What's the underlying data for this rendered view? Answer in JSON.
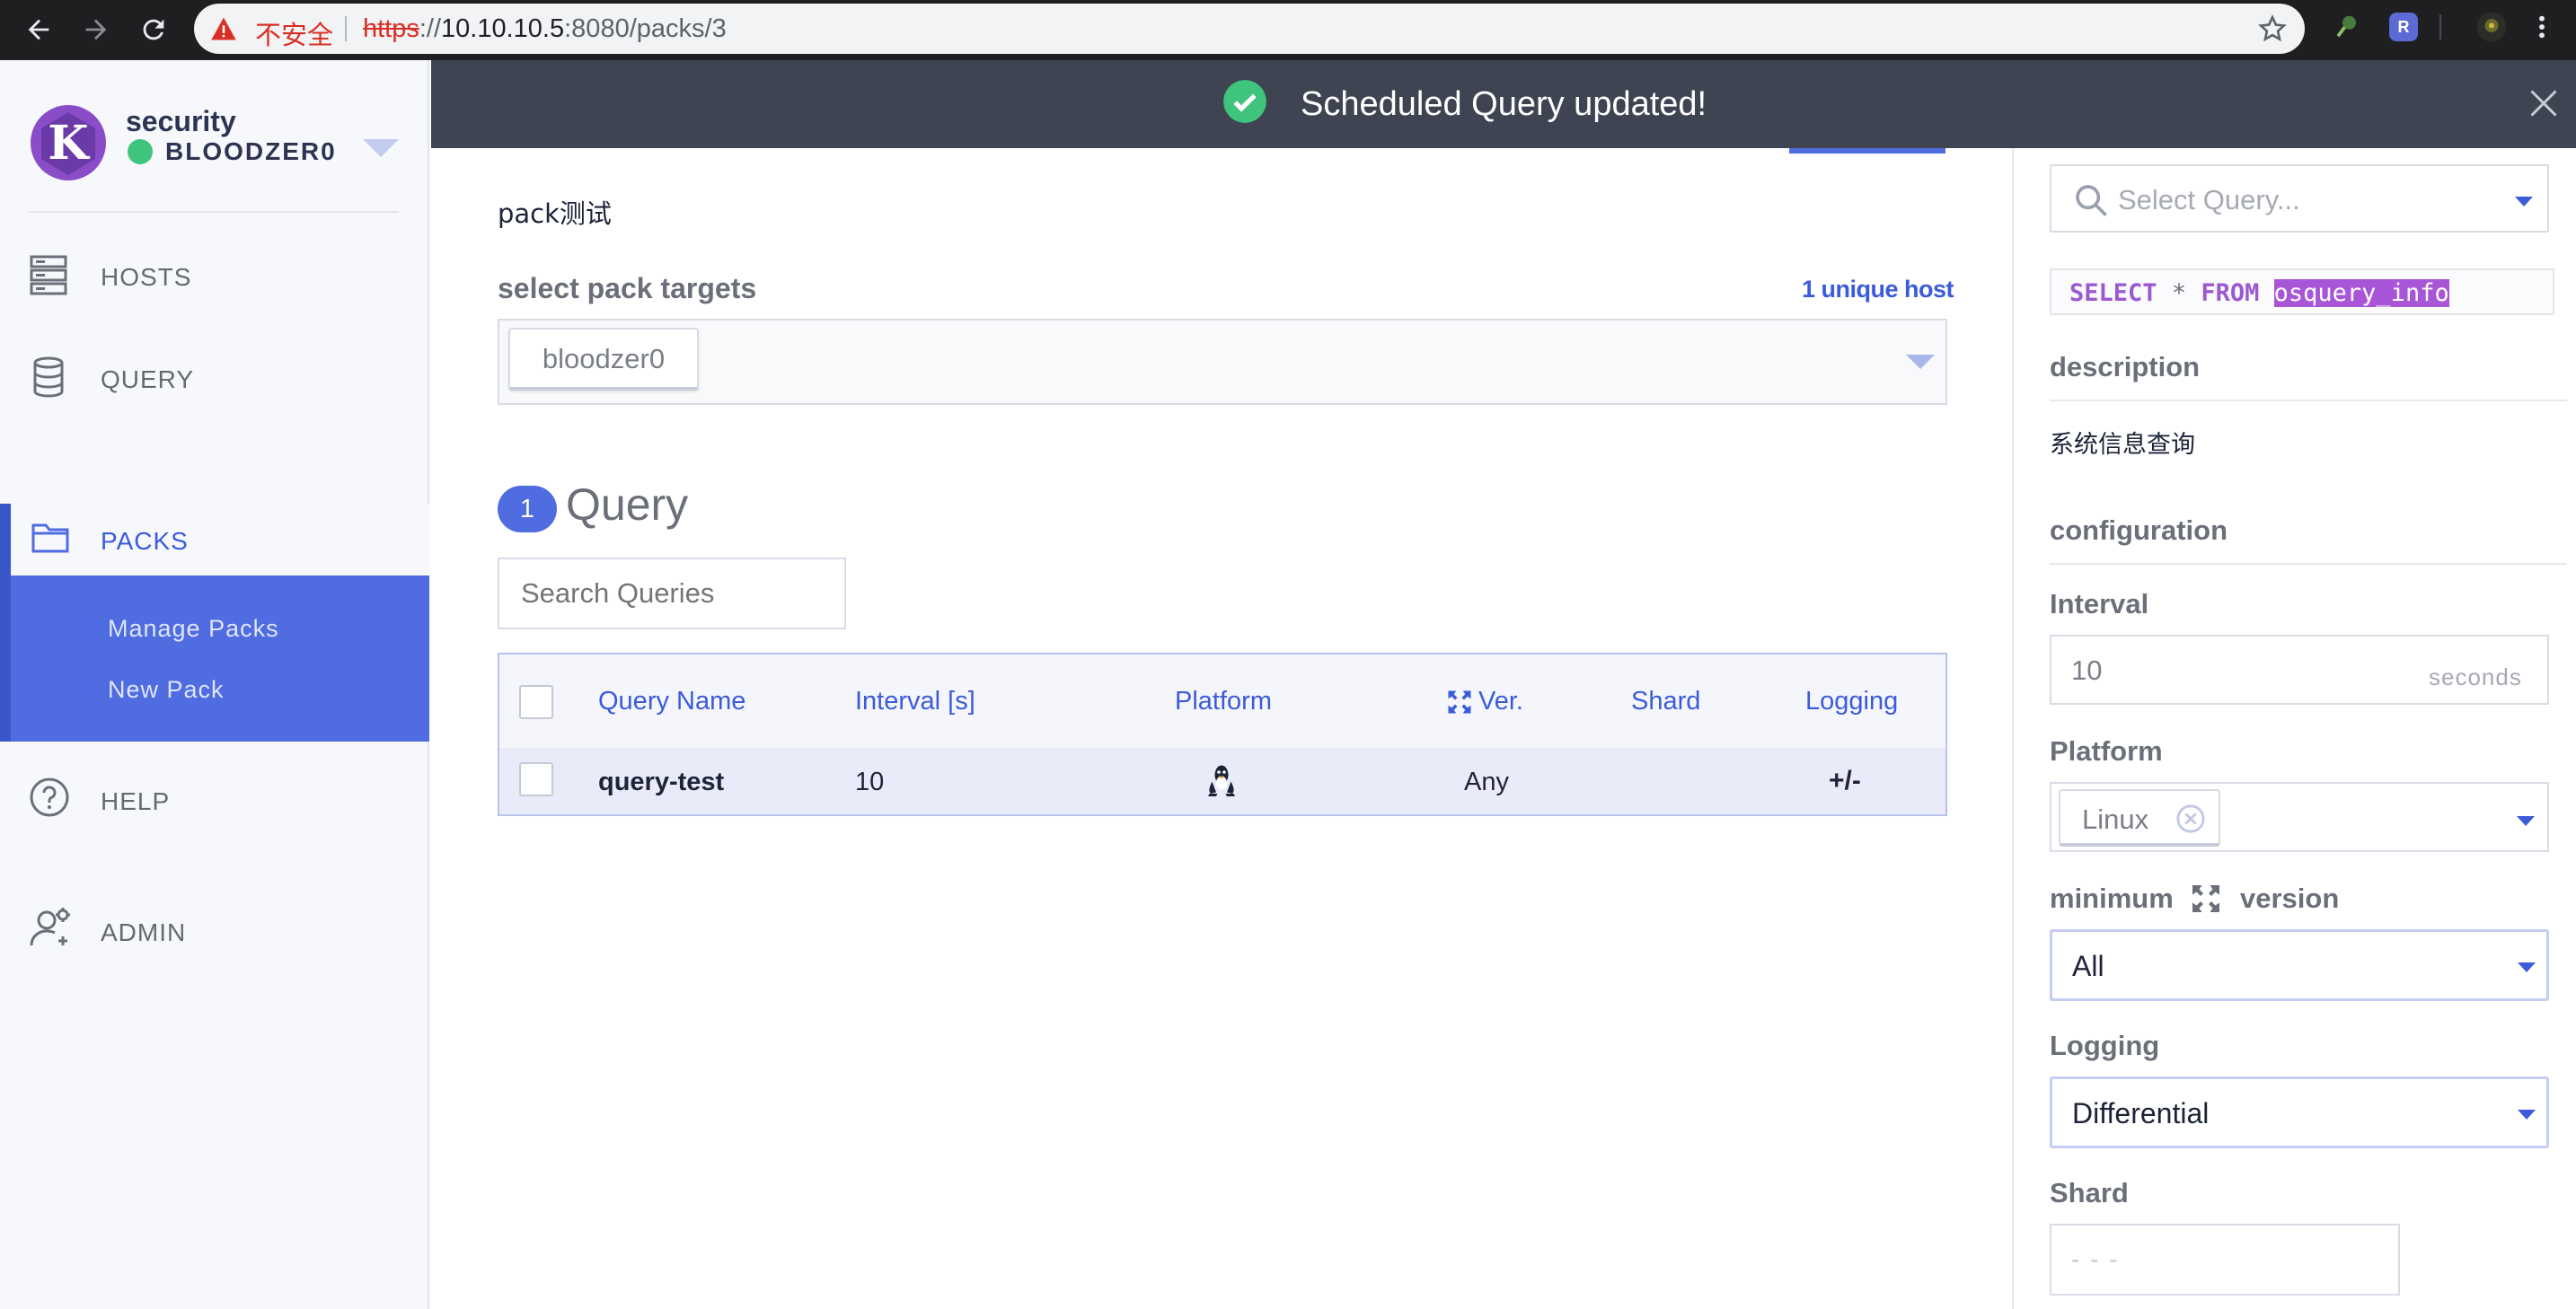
{
  "browser": {
    "insecure_label": "不安全",
    "url_protocol": "https",
    "url_sep": "://",
    "url_host": "10.10.10.5",
    "url_rest": ":8080/packs/3",
    "ext_r_label": "R"
  },
  "sidebar": {
    "org_name": "security",
    "user_name": "BLOODZER0",
    "logo_letter": "K",
    "items": [
      {
        "label": "HOSTS"
      },
      {
        "label": "QUERY"
      },
      {
        "label": "PACKS"
      },
      {
        "label": "HELP"
      },
      {
        "label": "ADMIN"
      }
    ],
    "packs_sub": [
      "Manage Packs",
      "New Pack"
    ]
  },
  "toast": {
    "message": "Scheduled Query updated!"
  },
  "main": {
    "pack_name": "pack测试",
    "targets_label": "select pack targets",
    "unique_hosts": "1 unique host",
    "target_chip": "bloodzer0",
    "query_count": "1",
    "query_heading": "Query",
    "search_placeholder": "Search Queries",
    "table": {
      "headers": [
        "Query Name",
        "Interval [s]",
        "Platform",
        "Ver.",
        "Shard",
        "Logging"
      ],
      "rows": [
        {
          "name": "query-test",
          "interval": "10",
          "platform_icon": "linux-icon",
          "version": "Any",
          "shard": "",
          "logging": "+/-"
        }
      ]
    }
  },
  "panel": {
    "select_query_placeholder": "Select Query...",
    "sql_kw1": "SELECT",
    "sql_star": "*",
    "sql_kw2": "FROM",
    "sql_table": "osquery_info",
    "description_label": "description",
    "description_text": "系统信息查询",
    "configuration_label": "configuration",
    "interval_label": "Interval",
    "interval_value": "10",
    "interval_unit": "seconds",
    "platform_label": "Platform",
    "platform_chip": "Linux",
    "min_version_label_a": "minimum",
    "min_version_label_b": "version",
    "min_version_value": "All",
    "logging_label": "Logging",
    "logging_value": "Differential",
    "shard_label": "Shard",
    "shard_placeholder": "- - -"
  },
  "colors": {
    "accent": "#4f6ce0",
    "toast_bg": "#3e4452",
    "success": "#3fc47e",
    "sql_keyword": "#9b59d0",
    "sql_highlight": "#a855d8"
  }
}
